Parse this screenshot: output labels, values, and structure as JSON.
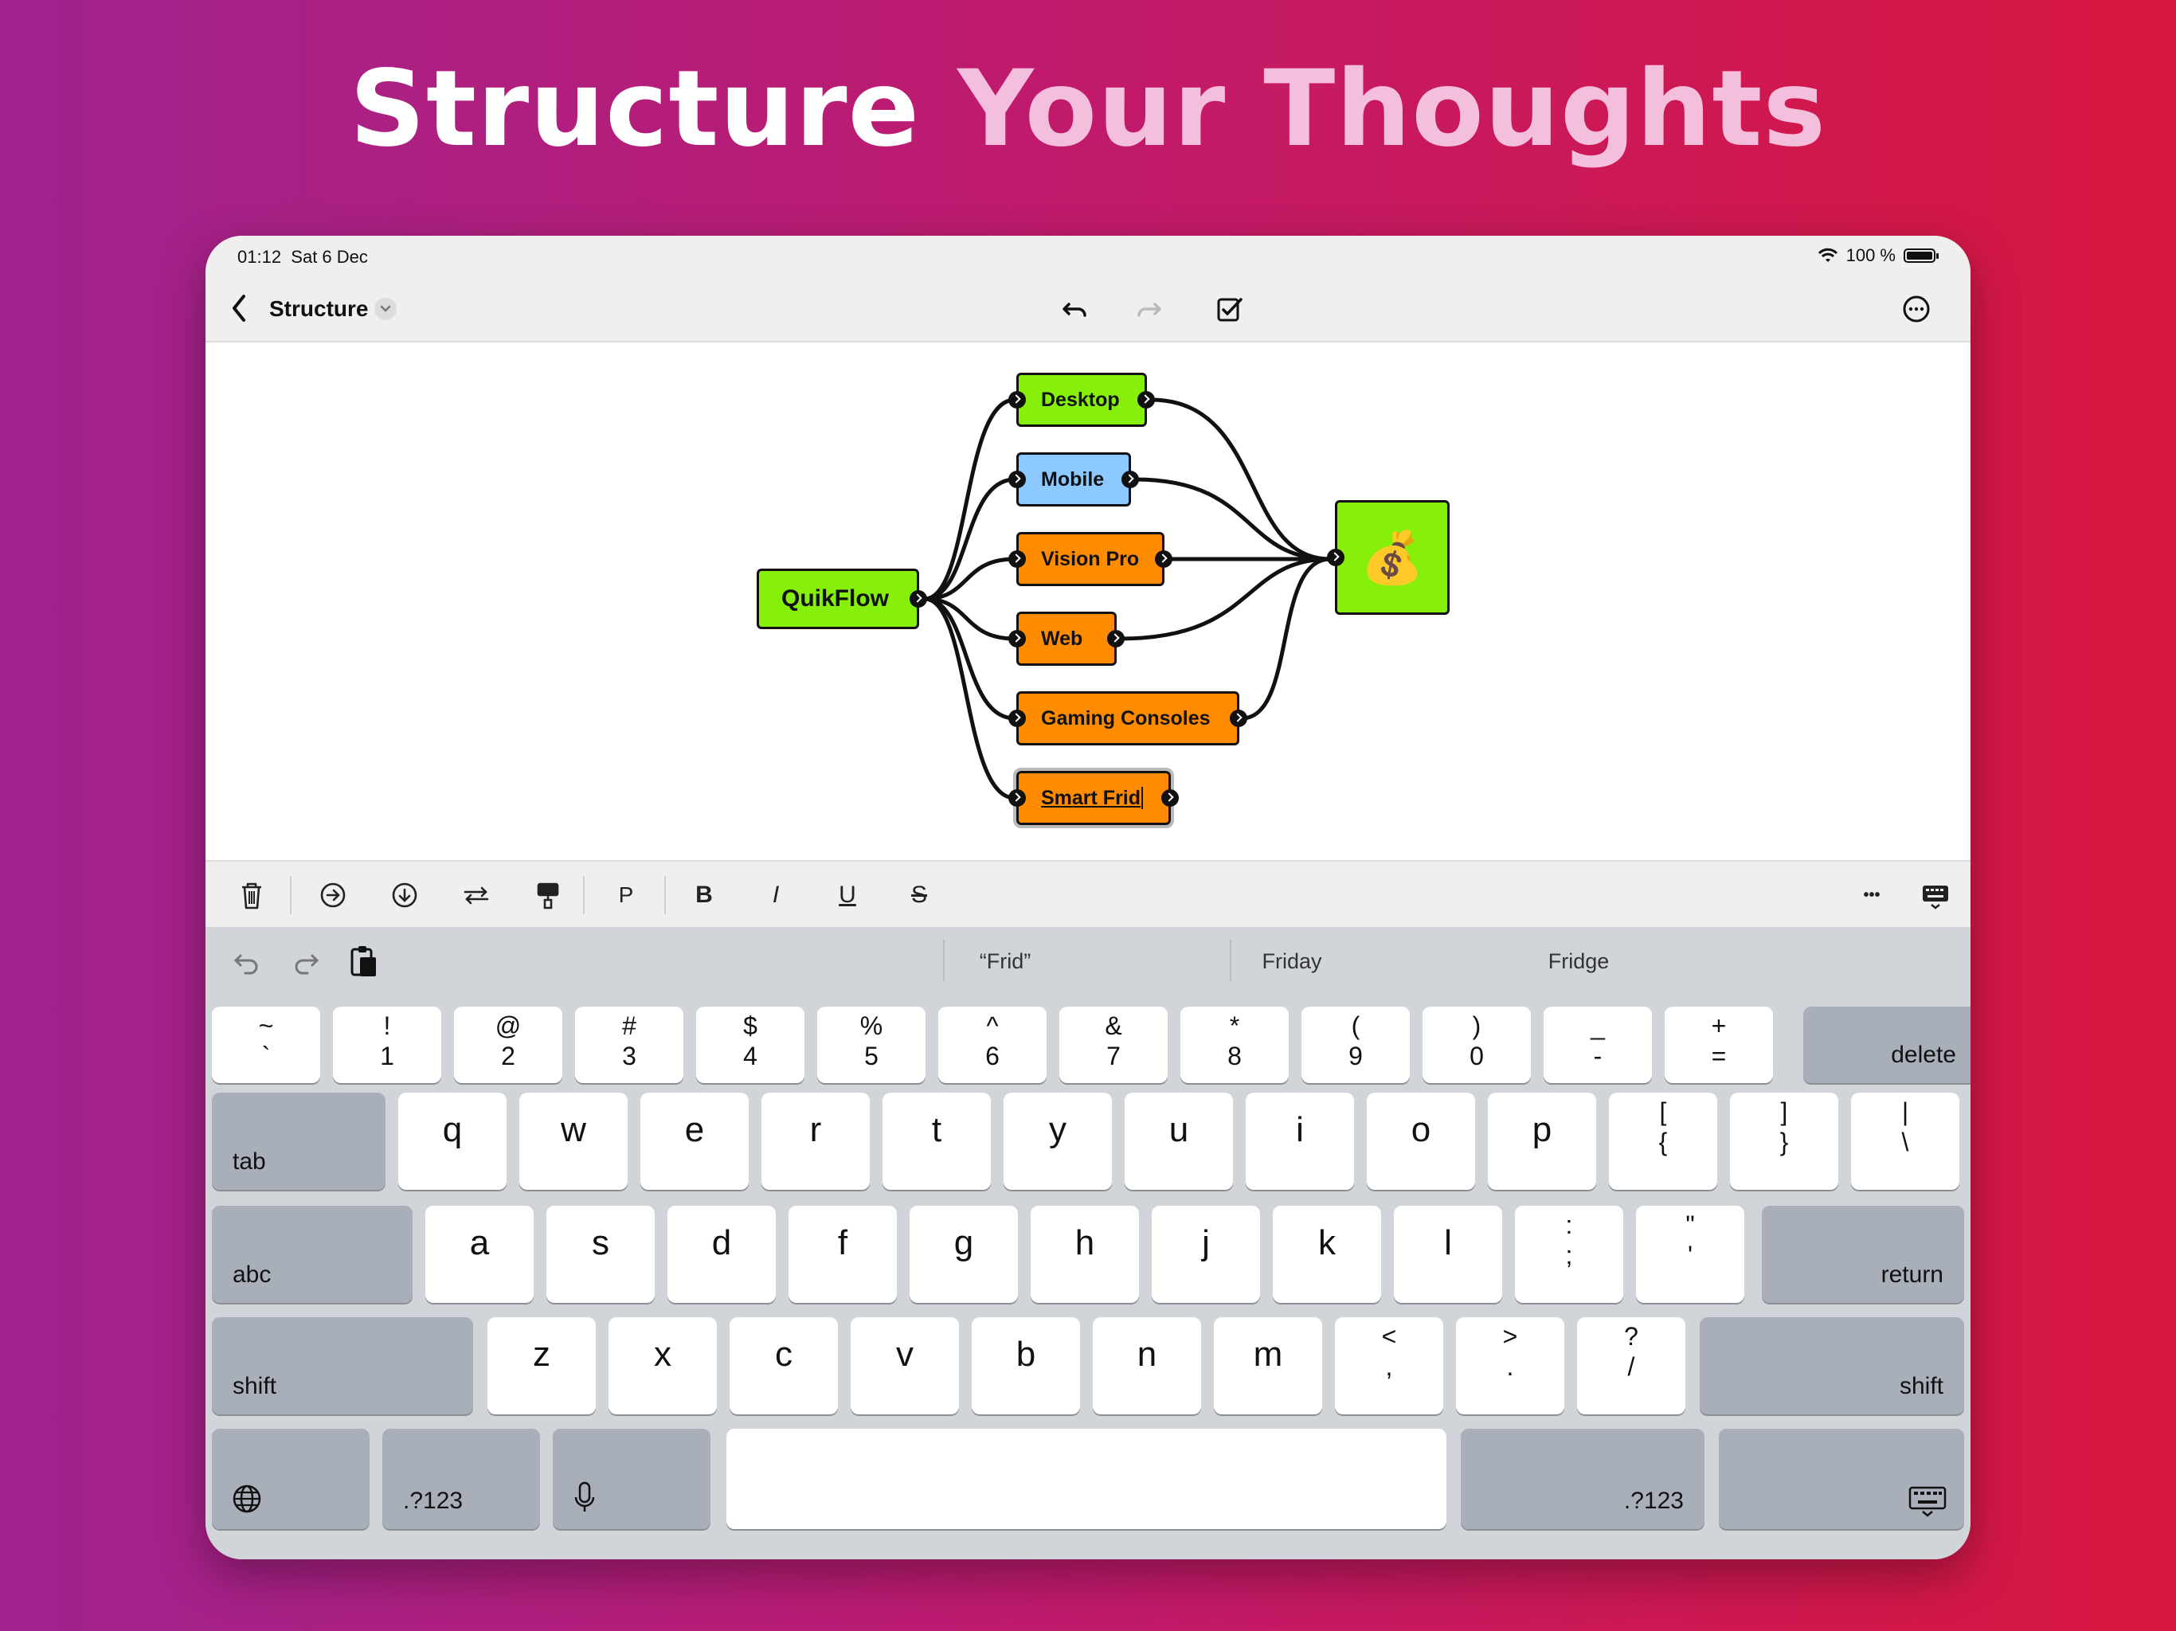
{
  "headline": {
    "part1": "Structure",
    "part2": "Your Thoughts"
  },
  "status": {
    "time": "01:12",
    "date": "Sat 6 Dec",
    "battery": "100 %",
    "battery_level": 1.0
  },
  "nav": {
    "title": "Structure"
  },
  "diagram": {
    "root": "QuikFlow",
    "children": [
      "Desktop",
      "Mobile",
      "Vision Pro",
      "Web",
      "Gaming Consoles",
      "Smart Frid"
    ],
    "target": "💰"
  },
  "format": {
    "paragraph": "P",
    "bold": "B",
    "italic": "I",
    "underline": "U",
    "strike": "S",
    "more": "•••"
  },
  "suggestions": [
    "“Frid”",
    "Friday",
    "Fridge"
  ],
  "keys": {
    "numrow": [
      [
        "~",
        "`"
      ],
      [
        "!",
        "1"
      ],
      [
        "@",
        "2"
      ],
      [
        "#",
        "3"
      ],
      [
        "$",
        "4"
      ],
      [
        "%",
        "5"
      ],
      [
        "^",
        "6"
      ],
      [
        "&",
        "7"
      ],
      [
        "*",
        "8"
      ],
      [
        "(",
        "9"
      ],
      [
        ")",
        "0"
      ],
      [
        "_",
        "-"
      ],
      [
        "+",
        "="
      ]
    ],
    "row1": [
      "q",
      "w",
      "e",
      "r",
      "t",
      "y",
      "u",
      "i",
      "o",
      "p"
    ],
    "row1_sym": [
      [
        "[",
        "{"
      ],
      [
        "]",
        "}"
      ],
      [
        "|",
        "\\"
      ]
    ],
    "row2": [
      "a",
      "s",
      "d",
      "f",
      "g",
      "h",
      "j",
      "k",
      "l"
    ],
    "row2_sym": [
      [
        ":",
        ";"
      ],
      [
        "\"",
        "'"
      ]
    ],
    "row3": [
      "z",
      "x",
      "c",
      "v",
      "b",
      "n",
      "m"
    ],
    "row3_sym": [
      [
        "<",
        ","
      ],
      [
        ">",
        "."
      ],
      [
        "?",
        "/"
      ]
    ],
    "delete": "delete",
    "tab": "tab",
    "abc": "abc",
    "return": "return",
    "shift": "shift",
    "numbers": ".?123"
  },
  "colors": {
    "green": "#87f00a",
    "blue": "#8cc9ff",
    "orange": "#ff8c00"
  }
}
